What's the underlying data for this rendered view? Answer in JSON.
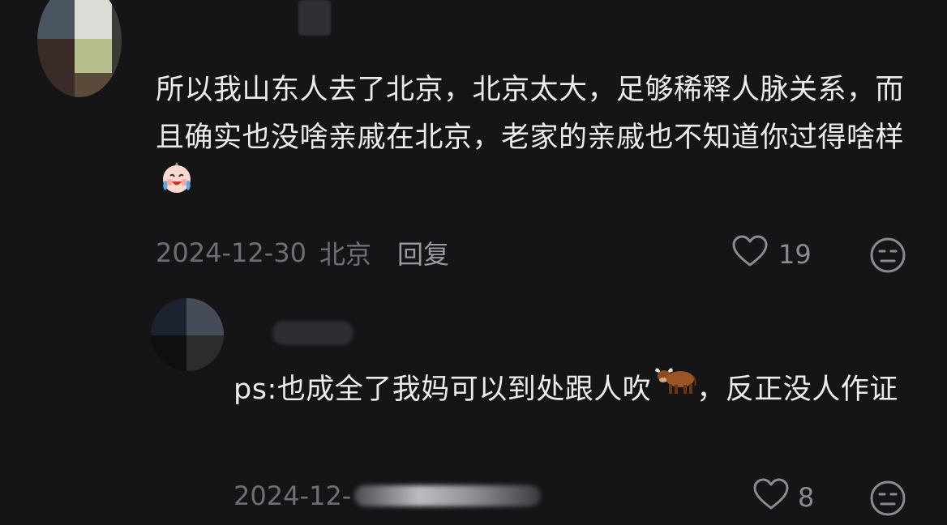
{
  "comment": {
    "text": "所以我山东人去了北京，北京太大，足够稀释人脉关系，而且确实也没啥亲戚在北京，老家的亲戚也不知道你过得啥样",
    "date": "2024-12-30",
    "location": "北京",
    "reply_label": "回复",
    "like_count": "19",
    "emoji_icon": "crying-laughing-face-icon"
  },
  "reply": {
    "text": "ps:也成全了我妈可以到处跟人吹",
    "text_after_emoji": "，反正没人作证",
    "date_visible": "2024-12-",
    "like_count": "8",
    "emoji_icon": "ox-icon"
  },
  "colors": {
    "background": "#151518",
    "text": "#ececee",
    "meta": "#6e6e74",
    "icon": "#8a8a90"
  }
}
